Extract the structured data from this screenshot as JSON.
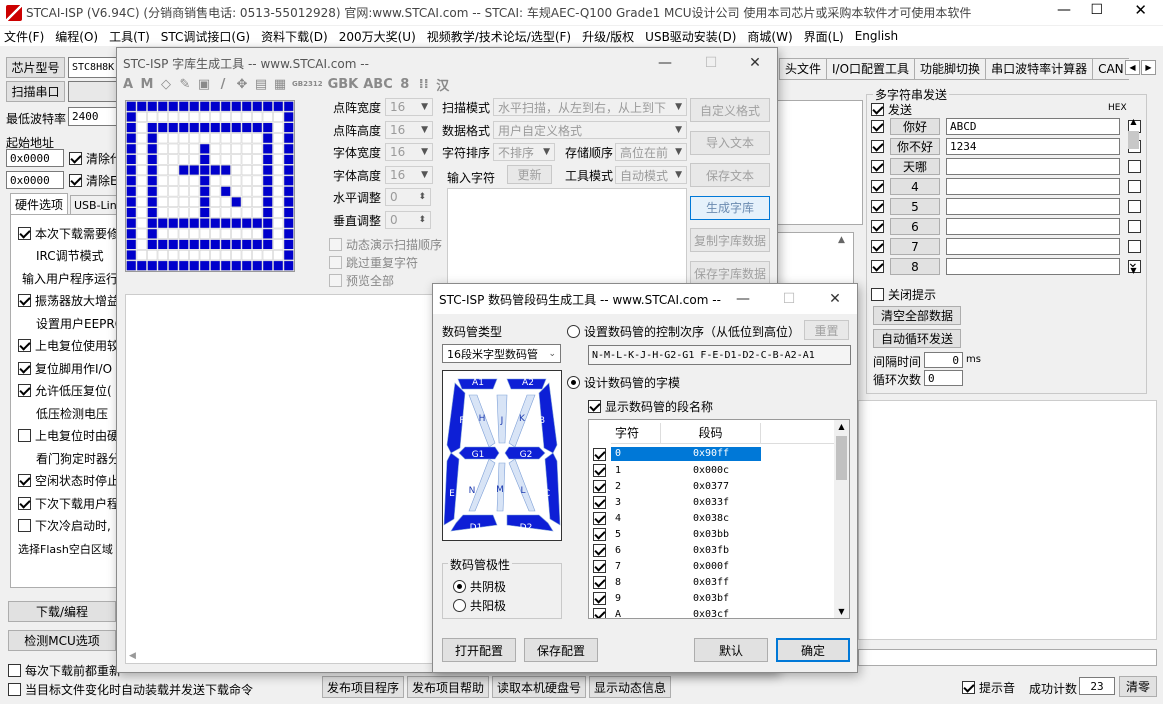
{
  "app": {
    "title": "STCAI-ISP (V6.94C) (分销商销售电话: 0513-55012928) 官网:www.STCAI.com  -- STCAI: 车规AEC-Q100 Grade1 MCU设计公司 使用本司芯片或采购本软件才可使用本软件"
  },
  "menu": [
    "文件(F)",
    "编程(O)",
    "工具(T)",
    "STC调试接口(G)",
    "资料下载(D)",
    "200万大奖(U)",
    "视频教学/技术论坛/选型(F)",
    "升级/版权",
    "USB驱动安装(D)",
    "商城(W)",
    "界面(L)",
    "English"
  ],
  "left": {
    "chip_label": "芯片型号",
    "chip_value": "STC8H8K",
    "scan_label": "扫描串口",
    "baud_min_label": "最低波特率",
    "baud_min": "2400",
    "start_addr_label": "起始地址",
    "addr1": "0x0000",
    "addr2": "0x0000",
    "clear1": "清除代",
    "clear2": "清除E",
    "tab_hw": "硬件选项",
    "tab_usb": "USB-Lin",
    "options": [
      {
        "label": "本次下载需要修",
        "checked": true,
        "indent": false
      },
      {
        "label": "IRC调节模式",
        "checked": null,
        "indent": true
      },
      {
        "label": "输入用户程序运行",
        "checked": null,
        "indent": false
      },
      {
        "label": "振荡器放大增益",
        "checked": true,
        "indent": false
      },
      {
        "label": "设置用户EEPRO",
        "checked": null,
        "indent": true
      },
      {
        "label": "上电复位使用较",
        "checked": true,
        "indent": false
      },
      {
        "label": "复位脚用作I/O",
        "checked": true,
        "indent": false
      },
      {
        "label": "允许低压复位(",
        "checked": true,
        "indent": false
      },
      {
        "label": "低压检测电压",
        "checked": null,
        "indent": true
      },
      {
        "label": "上电复位时由硬",
        "checked": false,
        "indent": false
      },
      {
        "label": "看门狗定时器分",
        "checked": null,
        "indent": true
      },
      {
        "label": "空闲状态时停止",
        "checked": true,
        "indent": false
      },
      {
        "label": "下次下载用户程",
        "checked": true,
        "indent": false
      },
      {
        "label": "下次冷启动时,",
        "checked": false,
        "indent": false
      }
    ],
    "flash_label": "选择Flash空白区域",
    "download_btn": "下载/编程",
    "detect_btn": "检测MCU选项",
    "each_download": "每次下载前都重新",
    "auto_reload": "当目标文件变化时自动装载并发送下载命令"
  },
  "right_tabs": [
    "头文件",
    "I/O口配置工具",
    "功能脚切换",
    "串口波特率计算器",
    "CAN"
  ],
  "multi_send": {
    "title": "多字符串发送",
    "send_label": "发送",
    "hex_label": "HEX",
    "rows": [
      {
        "btn": "你好",
        "value": "ABCD"
      },
      {
        "btn": "你不好",
        "value": "1234"
      },
      {
        "btn": "天哪",
        "value": ""
      },
      {
        "btn": "4",
        "value": ""
      },
      {
        "btn": "5",
        "value": ""
      },
      {
        "btn": "6",
        "value": ""
      },
      {
        "btn": "7",
        "value": ""
      },
      {
        "btn": "8",
        "value": ""
      }
    ],
    "close_hint": "关闭提示",
    "clear_all": "清空全部数据",
    "auto_loop": "自动循环发送",
    "interval_label": "间隔时间",
    "interval": "0",
    "ms": "ms",
    "loop_label": "循环次数",
    "loop": "0"
  },
  "bottom": {
    "btns": [
      "发布项目程序",
      "发布项目帮助",
      "读取本机硬盘号",
      "显示动态信息"
    ],
    "beep": "提示音",
    "success_label": "成功计数",
    "success": "23",
    "clear": "清零"
  },
  "font_tool": {
    "title": "STC-ISP 字库生成工具 -- www.STCAI.com --",
    "toolbar": [
      "A",
      "M",
      "◇",
      "✎",
      "▣",
      "/",
      "✥",
      "▤",
      "▦",
      "GB2312",
      "GBK",
      "ABC",
      "8",
      "⁞⁞",
      "汉"
    ],
    "width_label": "点阵宽度",
    "width": "16",
    "height_label": "点阵高度",
    "height": "16",
    "fw_label": "字体宽度",
    "fw": "16",
    "fh_label": "字体高度",
    "fh": "16",
    "hadj_label": "水平调整",
    "hadj": "0",
    "vadj_label": "垂直调整",
    "vadj": "0",
    "anim": "动态演示扫描顺序",
    "skip": "跳过重复字符",
    "preview": "预览全部",
    "scan_label": "扫描模式",
    "scan": "水平扫描，从左到右，从上到下",
    "data_label": "数据格式",
    "data": "用户自定义格式",
    "sort_label": "字符排序",
    "sort": "不排序",
    "order_label": "存储顺序",
    "order": "高位在前",
    "input_label": "输入字符",
    "update_btn": "更新",
    "mode_label": "工具模式",
    "mode": "自动模式",
    "btns": [
      "自定义格式",
      "导入文本",
      "保存文本",
      "生成字库",
      "复制字库数据",
      "保存字库数据"
    ],
    "grid": [
      "1111111111111111",
      "1000000000000001",
      "1011111111111101",
      "1010000000000101",
      "1010000100000101",
      "1010000100000101",
      "1010011111000101",
      "1010000100000101",
      "1010000101000101",
      "1010000100100101",
      "1010000100000101",
      "1011111111111101",
      "1010000000000101",
      "1011111111111101",
      "1000000000000001",
      "1111111111111111"
    ]
  },
  "seg_tool": {
    "title": "STC-ISP 数码管段码生成工具 -- www.STCAI.com --",
    "type_label": "数码管类型",
    "type": "16段米字型数码管",
    "polarity_label": "数码管极性",
    "common_cathode": "共阴极",
    "common_anode": "共阳极",
    "order_radio": "设置数码管的控制次序（从低位到高位）",
    "reset_btn": "重置",
    "order_value": "N-M-L-K-J-H-G2-G1  F-E-D1-D2-C-B-A2-A1",
    "design_radio": "设计数码管的字模",
    "show_names": "显示数码管的段名称",
    "col_char": "字符",
    "col_code": "段码",
    "rows": [
      {
        "c": "0",
        "v": "0x90ff"
      },
      {
        "c": "1",
        "v": "0x000c"
      },
      {
        "c": "2",
        "v": "0x0377"
      },
      {
        "c": "3",
        "v": "0x033f"
      },
      {
        "c": "4",
        "v": "0x038c"
      },
      {
        "c": "5",
        "v": "0x03bb"
      },
      {
        "c": "6",
        "v": "0x03fb"
      },
      {
        "c": "7",
        "v": "0x000f"
      },
      {
        "c": "8",
        "v": "0x03ff"
      },
      {
        "c": "9",
        "v": "0x03bf"
      },
      {
        "c": "A",
        "v": "0x03cf"
      }
    ],
    "seg_names": {
      "A1": "A1",
      "A2": "A2",
      "B": "B",
      "C": "C",
      "D1": "D1",
      "D2": "D2",
      "E": "E",
      "F": "F",
      "G1": "G1",
      "G2": "G2",
      "H": "H",
      "J": "J",
      "K": "K",
      "L": "L",
      "M": "M",
      "N": "N"
    },
    "open_btn": "打开配置",
    "save_btn": "保存配置",
    "default_btn": "默认",
    "ok_btn": "确定"
  },
  "colors": {
    "accent": "#0000cc",
    "seg_on": "#0d1fd6",
    "seg_off": "#d8e4f6",
    "select": "#0078d7"
  }
}
